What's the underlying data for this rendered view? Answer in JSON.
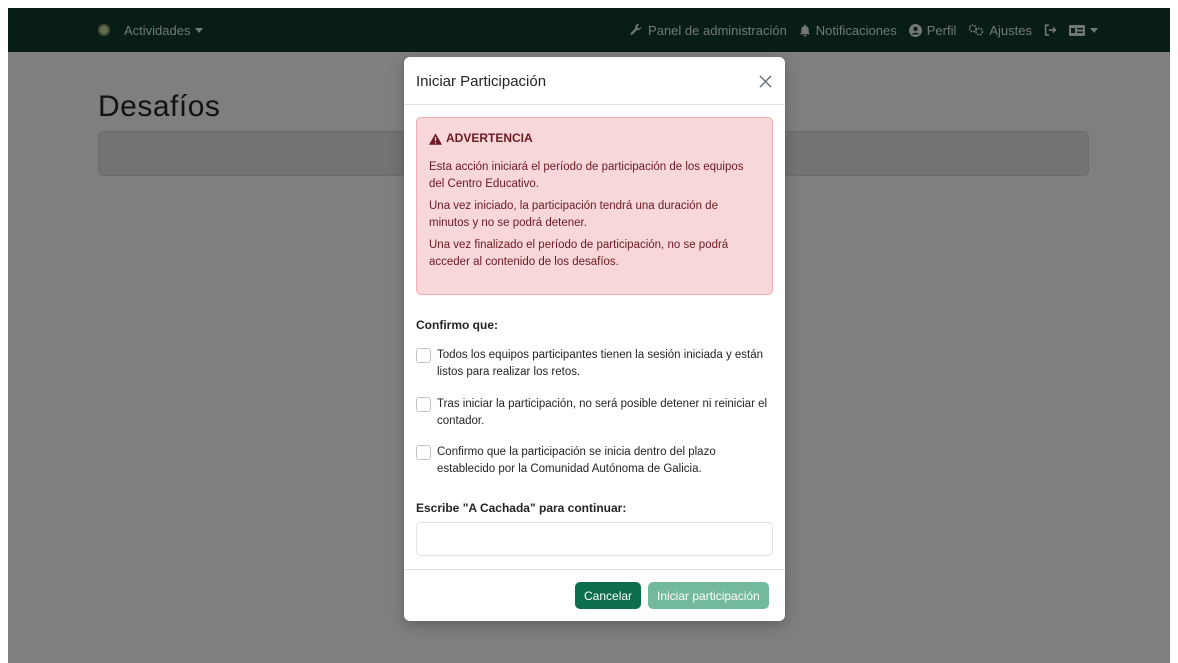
{
  "navbar": {
    "menu_label": "Actividades",
    "items": [
      {
        "label": "Panel de administración",
        "icon": "wrench-icon"
      },
      {
        "label": "Notificaciones",
        "icon": "bell-icon"
      },
      {
        "label": "Perfil",
        "icon": "user-circle-icon"
      },
      {
        "label": "Ajustes",
        "icon": "gears-icon"
      }
    ]
  },
  "page": {
    "title": "Desafíos"
  },
  "modal": {
    "title": "Iniciar Participación",
    "alert": {
      "title": "ADVERTENCIA",
      "p1": "Esta acción iniciará el período de participación de los equipos del Centro Educativo.",
      "p2": "Una vez iniciado, la participación tendrá una duración de minutos y no se podrá detener.",
      "p3": "Una vez finalizado el período de participación, no se podrá acceder al contenido de los desafíos."
    },
    "confirm_label": "Confirmo que:",
    "checks": [
      "Todos los equipos participantes tienen la sesión iniciada y están listos para realizar los retos.",
      "Tras iniciar la participación, no será posible detener ni reiniciar el contador.",
      "Confirmo que la participación se inicia dentro del plazo establecido por la Comunidad Autónoma de Galicia."
    ],
    "input_label": "Escribe \"A Cachada\" para continuar:",
    "input_value": "",
    "cancel_label": "Cancelar",
    "start_label": "Iniciar participación"
  },
  "colors": {
    "navbar": "#0e3b2a",
    "primary_button": "#0d6e4c",
    "disabled_button": "#73b99c",
    "alert_bg": "#f8d7da",
    "alert_text": "#6a1a21"
  }
}
